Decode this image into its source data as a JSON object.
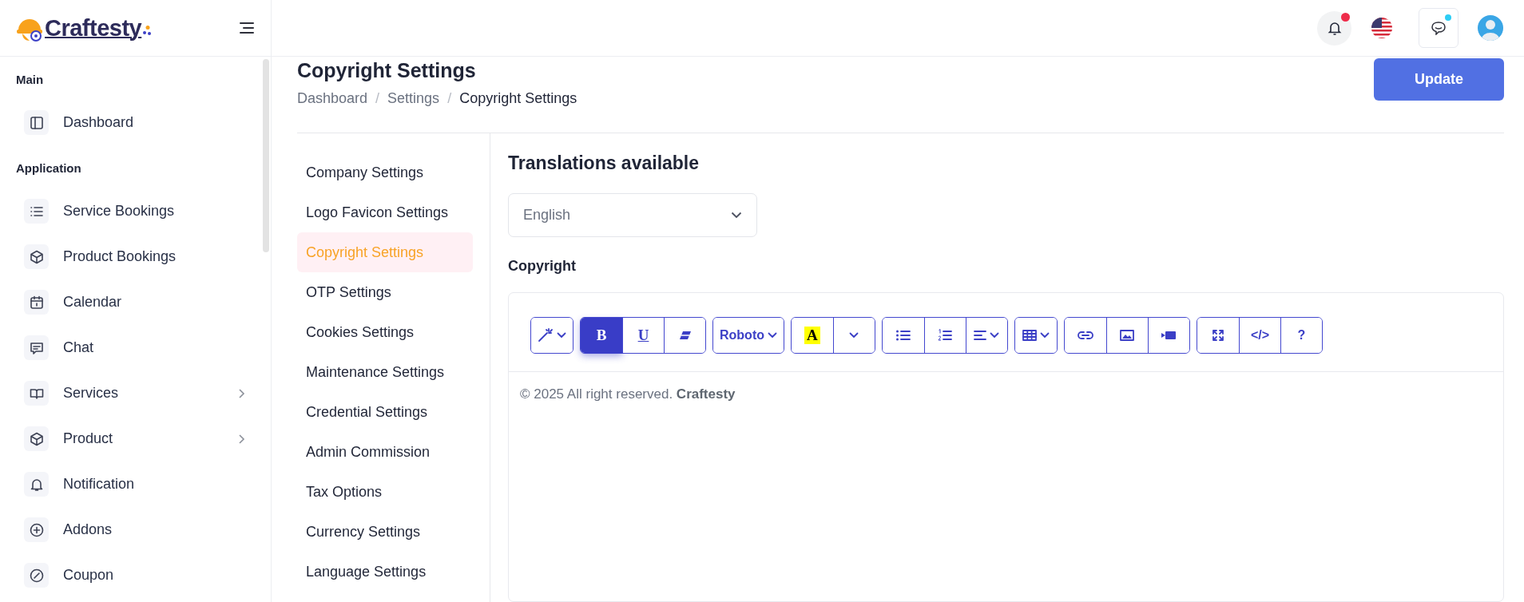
{
  "logo": {
    "text": "Craftesty"
  },
  "sidebar": {
    "sections": [
      {
        "title": "Main",
        "items": [
          {
            "label": "Dashboard",
            "has_submenu": false
          }
        ]
      },
      {
        "title": "Application",
        "items": [
          {
            "label": "Service Bookings",
            "has_submenu": false
          },
          {
            "label": "Product Bookings",
            "has_submenu": false
          },
          {
            "label": "Calendar",
            "has_submenu": false
          },
          {
            "label": "Chat",
            "has_submenu": false
          },
          {
            "label": "Services",
            "has_submenu": true
          },
          {
            "label": "Product",
            "has_submenu": true
          },
          {
            "label": "Notification",
            "has_submenu": false
          },
          {
            "label": "Addons",
            "has_submenu": false
          },
          {
            "label": "Coupon",
            "has_submenu": false
          }
        ]
      }
    ]
  },
  "page": {
    "title": "Copyright Settings",
    "breadcrumb_separator": "/",
    "breadcrumb": [
      {
        "label": "Dashboard",
        "current": false
      },
      {
        "label": "Settings",
        "current": false
      },
      {
        "label": "Copyright Settings",
        "current": true
      }
    ],
    "update_button": "Update"
  },
  "settings_menu": [
    {
      "label": "Company Settings",
      "selected": false
    },
    {
      "label": "Logo Favicon Settings",
      "selected": false
    },
    {
      "label": "Copyright Settings",
      "selected": true
    },
    {
      "label": "OTP Settings",
      "selected": false
    },
    {
      "label": "Cookies Settings",
      "selected": false
    },
    {
      "label": "Maintenance Settings",
      "selected": false
    },
    {
      "label": "Credential Settings",
      "selected": false
    },
    {
      "label": "Admin Commission",
      "selected": false
    },
    {
      "label": "Tax Options",
      "selected": false
    },
    {
      "label": "Currency Settings",
      "selected": false
    },
    {
      "label": "Language Settings",
      "selected": false
    }
  ],
  "form": {
    "translations_heading": "Translations available",
    "language": {
      "value": "English"
    },
    "copyright_label": "Copyright",
    "editor": {
      "toolbar": [
        [
          {
            "kind": "style",
            "active": false
          }
        ],
        [
          {
            "kind": "bold",
            "label": "B",
            "active": true
          },
          {
            "kind": "underline",
            "label": "U",
            "active": false
          },
          {
            "kind": "eraser",
            "active": false
          }
        ],
        [
          {
            "kind": "font",
            "label": "Roboto",
            "active": false
          }
        ],
        [
          {
            "kind": "color",
            "label": "A",
            "active": false
          },
          {
            "kind": "caret",
            "active": false
          }
        ],
        [
          {
            "kind": "bullets",
            "active": false
          },
          {
            "kind": "numbers",
            "active": false
          },
          {
            "kind": "align",
            "active": false
          }
        ],
        [
          {
            "kind": "table",
            "active": false
          }
        ],
        [
          {
            "kind": "link",
            "active": false
          },
          {
            "kind": "image",
            "active": false
          },
          {
            "kind": "video",
            "active": false
          }
        ],
        [
          {
            "kind": "fullscreen",
            "active": false
          },
          {
            "kind": "code",
            "label": "</>",
            "active": false
          },
          {
            "kind": "help",
            "label": "?",
            "active": false
          }
        ]
      ],
      "content": "© 2025 All right reserved. **Craftesty**"
    }
  }
}
